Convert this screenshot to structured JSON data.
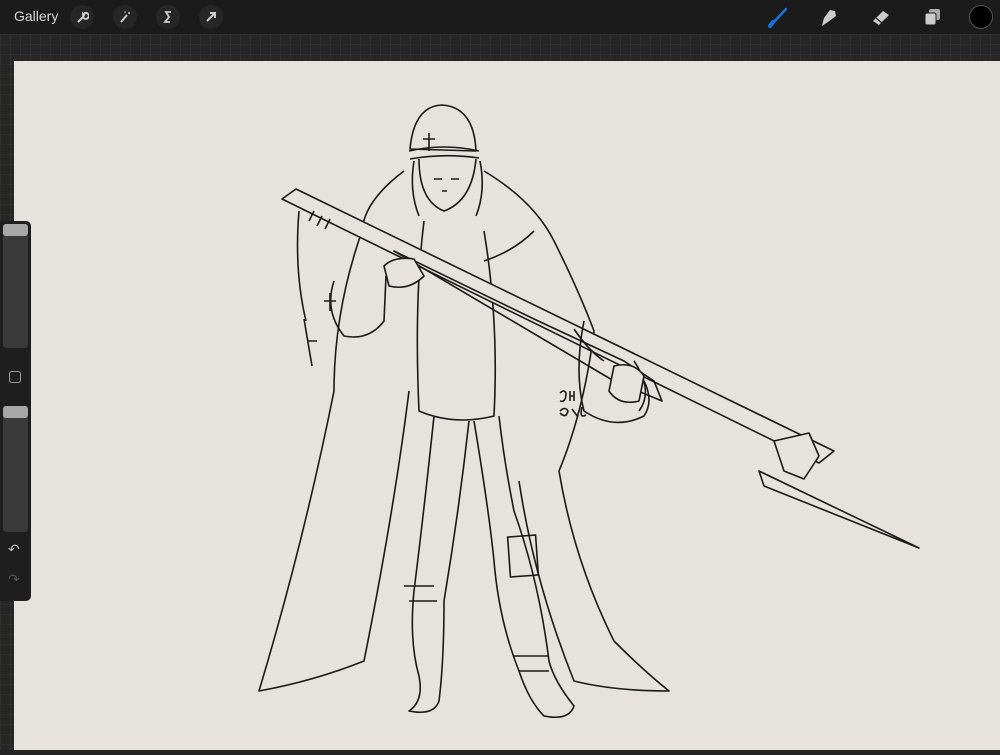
{
  "toolbar": {
    "gallery_label": "Gallery",
    "left_tools": [
      "wrench-icon",
      "magic-wand-icon",
      "selection-icon",
      "transform-arrow-icon"
    ],
    "right_tools": [
      "brush-icon",
      "smudge-icon",
      "eraser-icon",
      "layers-icon",
      "color-swatch"
    ],
    "active_tool": "brush",
    "active_color": "#1a6fe0",
    "current_color": "#000000"
  },
  "sidebar": {
    "brush_size": 1.0,
    "opacity": 1.0
  }
}
